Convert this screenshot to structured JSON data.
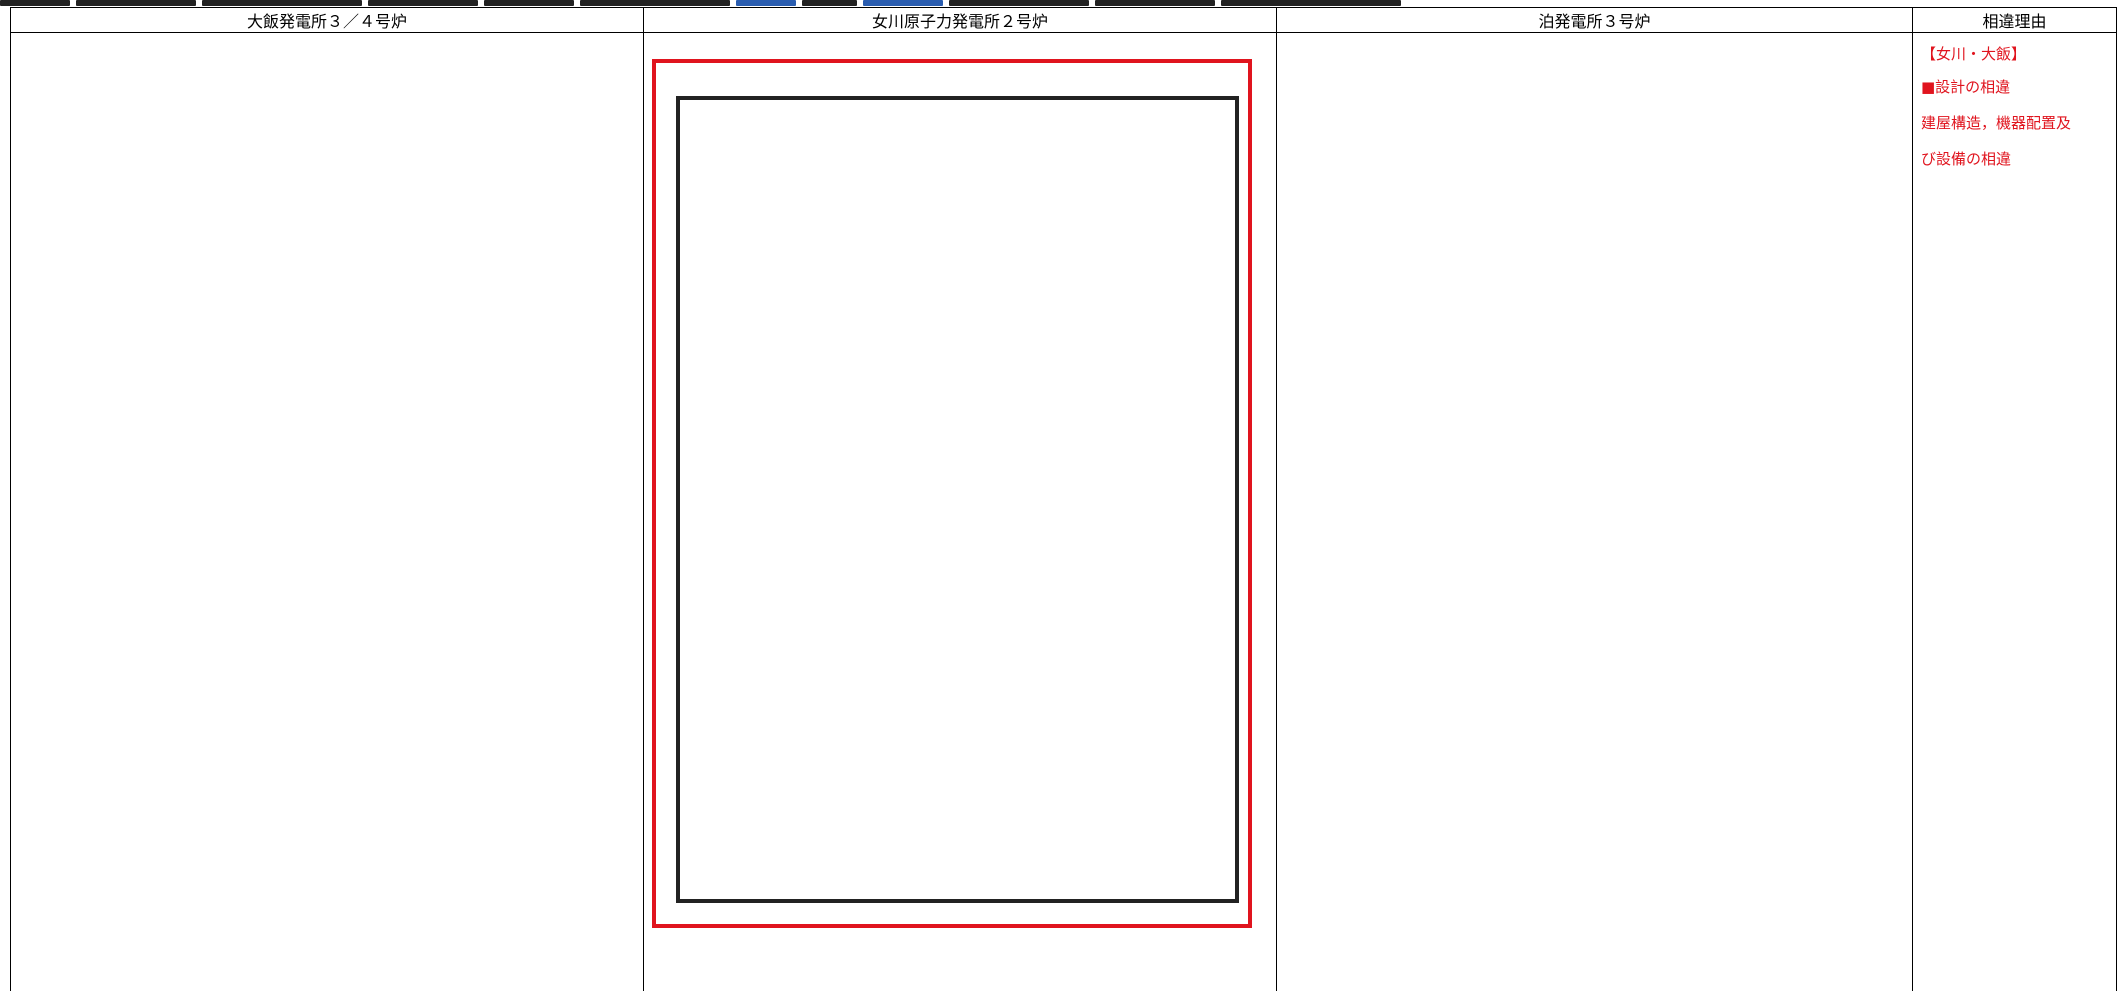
{
  "table": {
    "headers": {
      "ohi": "大飯発電所３／４号炉",
      "onagawa": "女川原子力発電所２号炉",
      "tomari": "泊発電所３号炉",
      "reason": "相違理由"
    },
    "reason_lines": [
      "【女川・大飯】",
      "■設計の相違",
      "建屋構造，機器配置及",
      "び設備の相違"
    ]
  },
  "colors": {
    "annotation_red": "#e0141e",
    "frame_black": "#222222",
    "caption_blue": "#2a5db0"
  }
}
